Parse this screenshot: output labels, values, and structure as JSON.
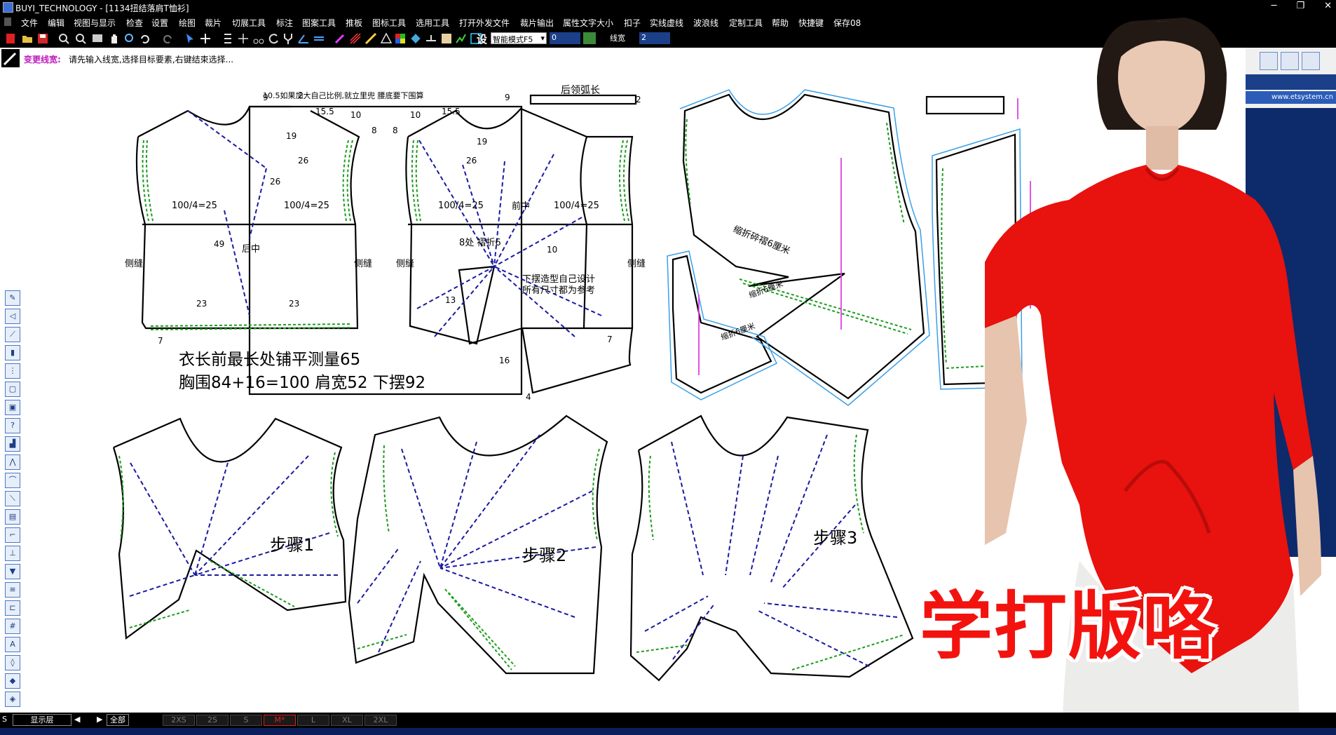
{
  "window": {
    "title": "BUYI_TECHNOLOGY - [1134扭结落肩T恤衫]",
    "controls": [
      "─",
      "❐",
      "✕"
    ]
  },
  "menu": [
    "文件",
    "编辑",
    "视图与显示",
    "检查",
    "设置",
    "绘图",
    "裁片",
    "切展工具",
    "标注",
    "图案工具",
    "推板",
    "图标工具",
    "选用工具",
    "打开外发文件",
    "裁片输出",
    "属性文字大小",
    "扣子",
    "实线虚线",
    "波浪线",
    "定制工具",
    "帮助",
    "快捷键",
    "保存08"
  ],
  "toolbar": {
    "mode_select": "智能模式F5",
    "mode_value": "0",
    "linewidth_label": "线宽",
    "linewidth_value": "2",
    "settings_glyph": "设"
  },
  "prompt": {
    "label": "变更线宽:",
    "message": "请先输入线宽,选择目标要素,右键结束选择..."
  },
  "right_panel": {
    "url": "www.etsystem.cn"
  },
  "status": {
    "layer_label": "显示层",
    "all_label": "全部",
    "sizes": [
      "2XS",
      "2S",
      "S",
      "M*",
      "L",
      "XL",
      "2XL"
    ],
    "s_label": "S"
  },
  "pattern": {
    "note_top": "10.5如果加大自己比例,就立里兜 腰底要下围算",
    "arc_label": "后领弧长",
    "back_center": "后中",
    "front_center": "前中",
    "side_seam": "侧缝",
    "bust_quarter": "100/4=25",
    "fold_pleat": "8处 褶折6",
    "design_note_1": "下摆造型自己设计",
    "design_note_2": "所有尺寸都为参考",
    "summary_1": "衣长前最长处铺平测量65",
    "summary_2": "胸围84+16=100   肩宽52   下摆92",
    "gather_1": "缩折碎褶6厘米",
    "gather_2": "缩折6厘米",
    "gather_3": "缩折6厘米",
    "step1": "步骤1",
    "step2": "步骤2",
    "step3": "步骤3",
    "dims": [
      "9",
      "2",
      "15.5",
      "10",
      "19",
      "26",
      "26",
      "8",
      "49",
      "23",
      "23",
      "7",
      "7",
      "16",
      "13",
      "10",
      "4",
      "2",
      "9",
      "10",
      "15.5",
      "8",
      "19",
      "26"
    ]
  },
  "overlay_text": "学打版咯",
  "colors": {
    "pleat_line": "#1a1aa0",
    "stitch": "#1e9e1e",
    "seam_allowance": "#3aa0e8",
    "grain": "#e040e0",
    "overlay": "#f2130f",
    "shirt": "#e8120e"
  }
}
